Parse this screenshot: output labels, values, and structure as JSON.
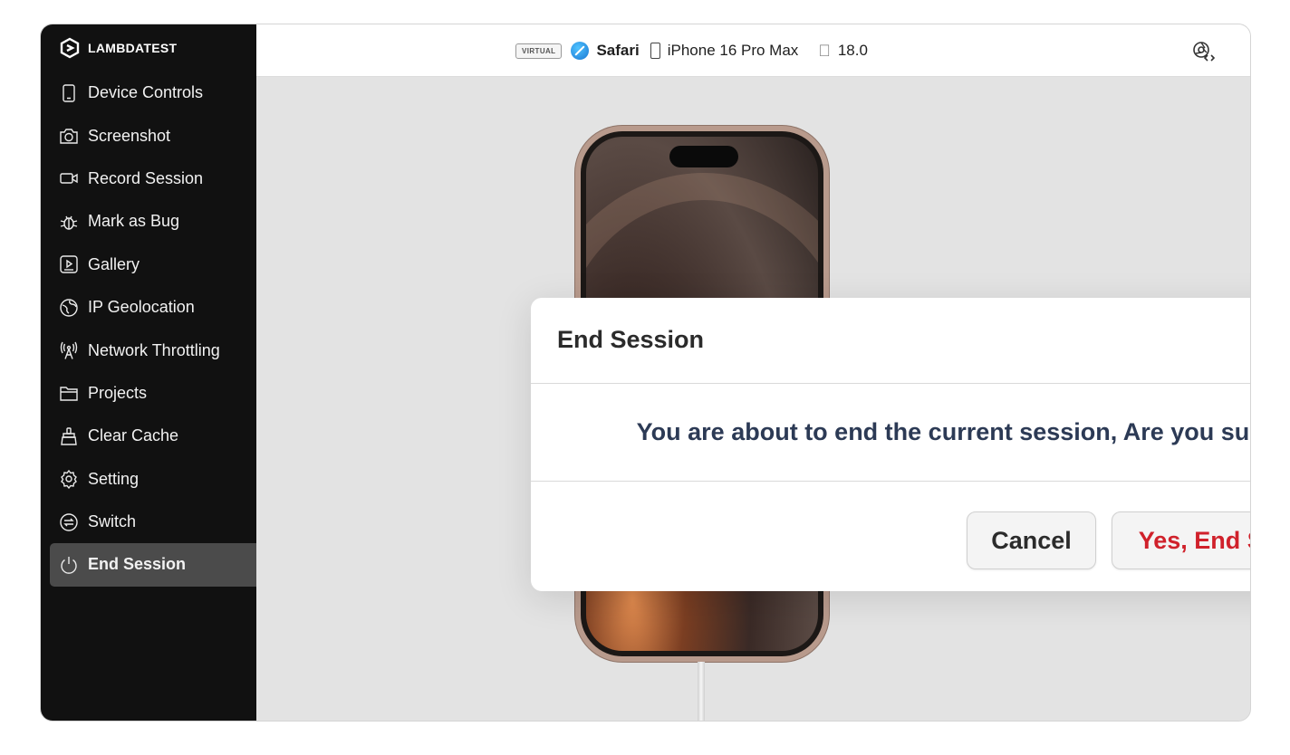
{
  "brand": {
    "name": "LAMBDATEST"
  },
  "sidebar": {
    "items": [
      {
        "label": "Device Controls",
        "icon": "phone-icon"
      },
      {
        "label": "Screenshot",
        "icon": "camera-icon"
      },
      {
        "label": "Record Session",
        "icon": "video-icon"
      },
      {
        "label": "Mark as Bug",
        "icon": "bug-icon"
      },
      {
        "label": "Gallery",
        "icon": "gallery-icon"
      },
      {
        "label": "IP Geolocation",
        "icon": "globe-icon"
      },
      {
        "label": "Network Throttling",
        "icon": "antenna-icon"
      },
      {
        "label": "Projects",
        "icon": "folder-icon"
      },
      {
        "label": "Clear Cache",
        "icon": "brush-icon"
      },
      {
        "label": "Setting",
        "icon": "gear-icon"
      },
      {
        "label": "Switch",
        "icon": "switch-icon"
      },
      {
        "label": "End Session",
        "icon": "power-icon",
        "active": true
      }
    ]
  },
  "topbar": {
    "tag": "VIRTUAL",
    "browser": "Safari",
    "device": "iPhone 16 Pro Max",
    "os_version": "18.0"
  },
  "modal": {
    "title": "End Session",
    "message": "You are about to end the current session, Are you sure?",
    "cancel_label": "Cancel",
    "confirm_label": "Yes, End Session"
  },
  "colors": {
    "sidebar_bg": "#111111",
    "active_item_bg": "#4b4b4b",
    "confirm_text": "#d0212b",
    "message_text": "#2c3a55"
  }
}
